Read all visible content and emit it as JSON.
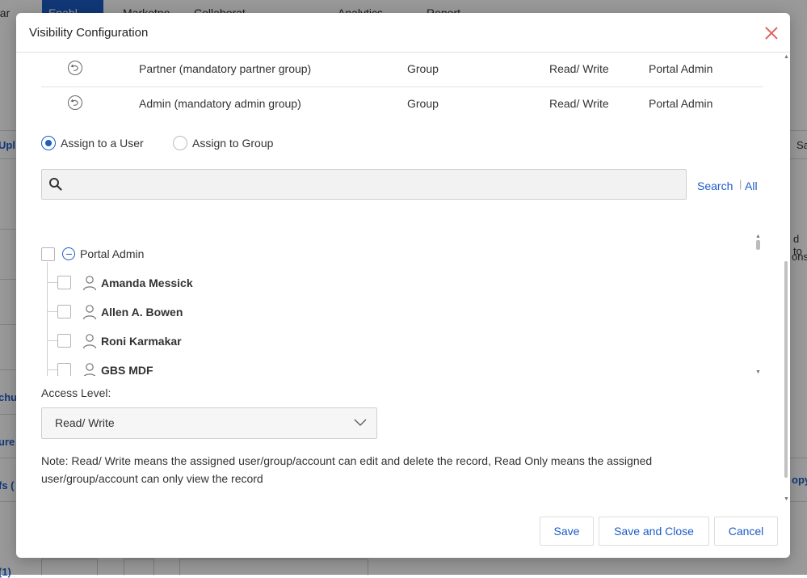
{
  "background": {
    "nav_fragments": [
      "par",
      "Enabl",
      "Marketpo",
      "Collaborat",
      "Analytics",
      "Report"
    ],
    "left_fragments": [
      "Upl",
      "chu",
      "ure",
      "fs (",
      "(1)"
    ],
    "right_fragments": [
      "Sa",
      "d to",
      "ons",
      "opy"
    ]
  },
  "modal": {
    "title": "Visibility Configuration",
    "close_label": "×"
  },
  "table": {
    "rows": [
      {
        "name": "Partner (mandatory partner group)",
        "type": "Group",
        "access": "Read/ Write",
        "assigned_by": "Portal Admin"
      },
      {
        "name": "Admin (mandatory admin group)",
        "type": "Group",
        "access": "Read/ Write",
        "assigned_by": "Portal Admin"
      }
    ]
  },
  "assign": {
    "user_label": "Assign to a User",
    "group_label": "Assign to Group",
    "selected": "user"
  },
  "search": {
    "value": "",
    "placeholder": "",
    "search_link": "Search",
    "separator": "|",
    "all_link": "All"
  },
  "tree": {
    "root": {
      "label": "Portal Admin",
      "checked": false,
      "expanded": true
    },
    "users": [
      {
        "name": "Amanda Messick",
        "checked": false
      },
      {
        "name": "Allen A. Bowen",
        "checked": false
      },
      {
        "name": "Roni Karmakar",
        "checked": false
      },
      {
        "name": "GBS MDF",
        "checked": false
      }
    ]
  },
  "access_level": {
    "label": "Access Level:",
    "selected": "Read/ Write"
  },
  "note": "Note: Read/ Write means the assigned user/group/account can edit and delete the record, Read Only means the assigned user/group/account can only view the record",
  "footer": {
    "save": "Save",
    "save_close": "Save and Close",
    "cancel": "Cancel"
  },
  "colors": {
    "accent": "#1d5cc7",
    "close": "#e06060"
  }
}
